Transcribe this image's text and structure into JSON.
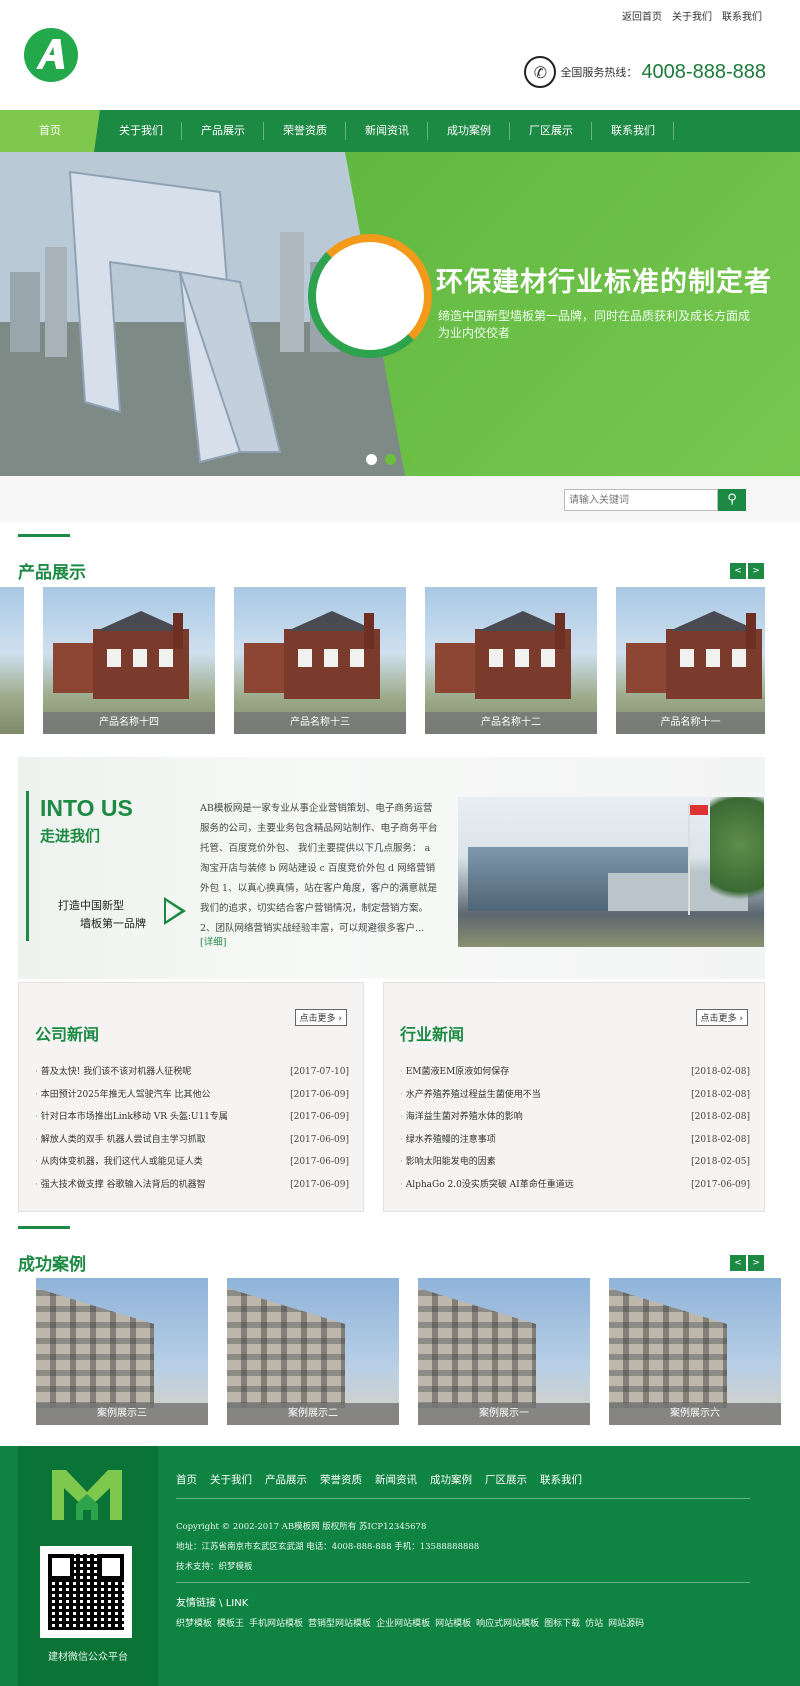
{
  "header": {
    "top_links": [
      "返回首页",
      "关于我们",
      "联系我们"
    ],
    "logo_letter": "A",
    "hotline_label": "全国服务热线：",
    "hotline_number": "4008-888-888"
  },
  "nav": [
    "首页",
    "关于我们",
    "产品展示",
    "荣誉资质",
    "新闻资讯",
    "成功案例",
    "厂区展示",
    "联系我们"
  ],
  "banner": {
    "title": "环保建材行业标准的制定者",
    "subtitle": "缔造中国新型墙板第一品牌，同时在品质获利及成长方面成为业内佼佼者",
    "active_slide": 1,
    "slide_count": 3
  },
  "search": {
    "placeholder": "请输入关键词",
    "icon": "search-icon"
  },
  "products": {
    "title": "产品展示",
    "items": [
      "产品名称十四",
      "产品名称十三",
      "产品名称十二",
      "产品名称十一"
    ]
  },
  "about": {
    "title_en": "INTO US",
    "title_cn": "走进我们",
    "slogan_line1": "打造中国新型",
    "slogan_line2": "墙板第一品牌",
    "text": "AB模板网是一家专业从事企业营销策划、电子商务运营服务的公司，主要业务包含精品网站制作、电子商务平台托管、百度竞价外包、 我们主要提供以下几点服务： a 淘宝开店与装修 b 网站建设 c 百度竞价外包 d 网络营销外包 1、以真心换真情，站在客户角度，客户的满意就是我们的追求，切实结合客户营销情况，制定营销方案。 2、团队网络营销实战经验丰富，可以规避很多客户...",
    "more": "[详细]"
  },
  "company_news": {
    "title": "公司新闻",
    "more": "点击更多",
    "items": [
      {
        "title": "普及太快! 我们该不该对机器人征税呢",
        "date": "[2017-07-10]"
      },
      {
        "title": "本田预计2025年推无人驾驶汽车 比其他公",
        "date": "[2017-06-09]"
      },
      {
        "title": "针对日本市场推出Link移动 VR 头盔:U11专属",
        "date": "[2017-06-09]"
      },
      {
        "title": "解放人类的双手 机器人尝试自主学习抓取",
        "date": "[2017-06-09]"
      },
      {
        "title": "从肉体变机器，我们这代人或能见证人类",
        "date": "[2017-06-09]"
      },
      {
        "title": "强大技术做支撑 谷歌输入法背后的机器智",
        "date": "[2017-06-09]"
      }
    ]
  },
  "industry_news": {
    "title": "行业新闻",
    "more": "点击更多",
    "items": [
      {
        "title": "EM菌液EM原液如何保存",
        "date": "[2018-02-08]"
      },
      {
        "title": "水产养殖养殖过程益生菌使用不当",
        "date": "[2018-02-08]"
      },
      {
        "title": "海洋益生菌对养殖水体的影响",
        "date": "[2018-02-08]"
      },
      {
        "title": "绿水养殖鳗的注意事项",
        "date": "[2018-02-08]"
      },
      {
        "title": "影响太阳能发电的因素",
        "date": "[2018-02-05]"
      },
      {
        "title": "AlphaGo 2.0没实质突破 AI革命任重道远",
        "date": "[2017-06-09]"
      }
    ]
  },
  "cases": {
    "title": "成功案例",
    "items": [
      "案例展示三",
      "案例展示二",
      "案例展示一",
      "案例展示六"
    ]
  },
  "footer": {
    "nav": [
      "首页",
      "关于我们",
      "产品展示",
      "荣誉资质",
      "新闻资讯",
      "成功案例",
      "厂区展示",
      "联系我们"
    ],
    "copyright": "Copyright © 2002-2017 AB模板网 版权所有 苏ICP12345678",
    "address": "地址：江苏省南京市玄武区玄武湖 电话：4008-888-888 手机：13588888888",
    "support": "技术支持：织梦模板",
    "links_title": "友情链接 \\ LINK",
    "links": [
      "织梦模板",
      "模板王",
      "手机网站模板",
      "营销型网站模板",
      "企业网站模板",
      "网站模板",
      "响应式网站模板",
      "图标下载",
      "仿站",
      "网站源码"
    ],
    "qr_caption": "建材微信公众平台"
  },
  "colors": {
    "primary": "#1d8a43",
    "light_green": "#7fc84e",
    "footer": "#0f8442",
    "accent_orange": "#f39a1a"
  }
}
